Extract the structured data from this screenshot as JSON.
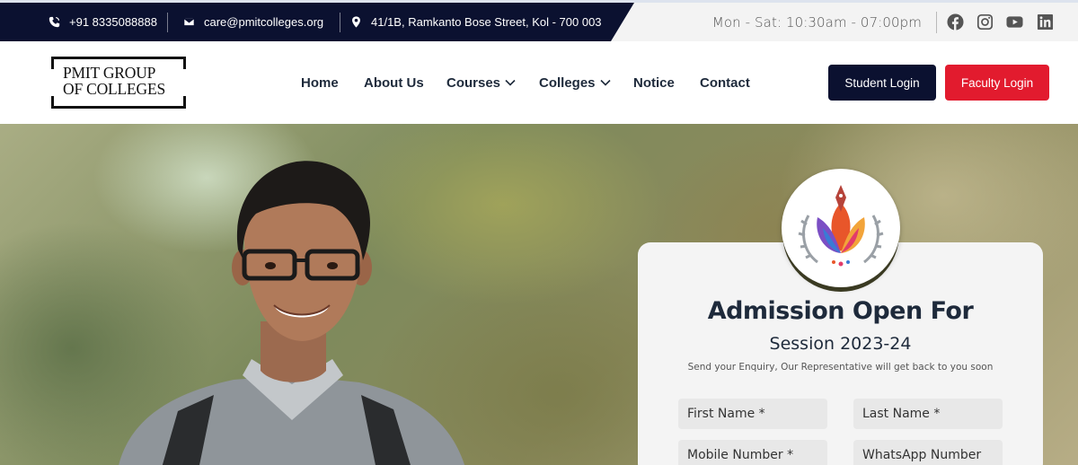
{
  "topbar": {
    "phone": "+91 8335088888",
    "email": "care@pmitcolleges.org",
    "address": "41/1B, Ramkanto Bose Street, Kol - 700 003",
    "hours": "Mon - Sat: 10:30am - 07:00pm",
    "social": [
      "facebook-icon",
      "instagram-icon",
      "youtube-icon",
      "linkedin-icon"
    ]
  },
  "logo": {
    "line1": "PMIT GROUP",
    "line2": "OF COLLEGES"
  },
  "nav": {
    "items": [
      {
        "label": "Home",
        "dropdown": false
      },
      {
        "label": "About Us",
        "dropdown": false
      },
      {
        "label": "Courses",
        "dropdown": true
      },
      {
        "label": "Colleges",
        "dropdown": true
      },
      {
        "label": "Notice",
        "dropdown": false
      },
      {
        "label": "Contact",
        "dropdown": false
      }
    ],
    "student_login": "Student Login",
    "faculty_login": "Faculty Login"
  },
  "admission": {
    "title": "Admission Open For",
    "session": "Session 2023-24",
    "subtitle": "Send your Enquiry, Our Representative will get back to you soon",
    "fields": {
      "first_name": "First Name *",
      "last_name": "Last Name *",
      "mobile": "Mobile Number *",
      "whatsapp": "WhatsApp Number"
    }
  },
  "colors": {
    "navy": "#0b1130",
    "red": "#e21b2e",
    "text_dark": "#1e2a3b"
  }
}
